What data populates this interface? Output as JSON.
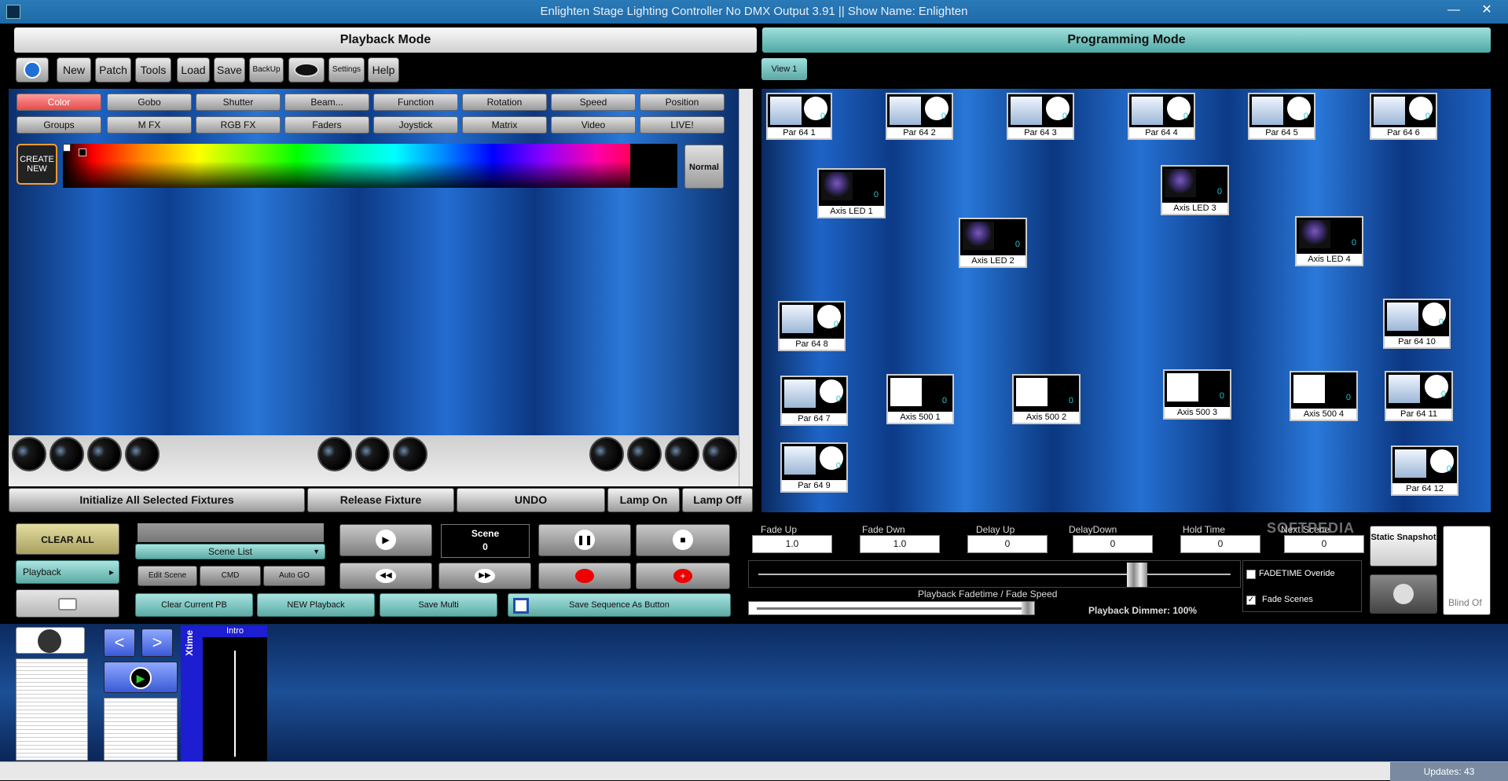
{
  "window": {
    "title": "Enlighten Stage Lighting Controller No DMX Output 3.91 || Show Name: Enlighten",
    "minimize": "—",
    "close": "✕"
  },
  "headers": {
    "playback": "Playback Mode",
    "programming": "Programming Mode"
  },
  "toolbar": {
    "items": [
      "New",
      "Patch",
      "Tools",
      "Load",
      "Save",
      "BackUp",
      "",
      "Settings",
      "Help"
    ]
  },
  "view": {
    "label": "View 1"
  },
  "tabs": {
    "row1": [
      "Color",
      "Gobo",
      "Shutter",
      "Beam...",
      "Function",
      "Rotation",
      "Speed",
      "Position"
    ],
    "row2": [
      "Groups",
      "M FX",
      "RGB FX",
      "Faders",
      "Joystick",
      "Matrix",
      "Video",
      "LIVE!"
    ],
    "active": "Color"
  },
  "color_panel": {
    "create_new": "CREATE NEW",
    "normal": "Normal"
  },
  "left_actions": [
    "Initialize All Selected Fixtures",
    "Release Fixture",
    "UNDO",
    "Lamp On",
    "Lamp Off"
  ],
  "fixtures": [
    {
      "name": "Par 64 1",
      "kind": "par",
      "value": "0"
    },
    {
      "name": "Par 64 2",
      "kind": "par",
      "value": "0"
    },
    {
      "name": "Par 64 3",
      "kind": "par",
      "value": "0"
    },
    {
      "name": "Par 64 4",
      "kind": "par",
      "value": "0"
    },
    {
      "name": "Par 64 5",
      "kind": "par",
      "value": "0"
    },
    {
      "name": "Par 64 6",
      "kind": "par",
      "value": "0"
    },
    {
      "name": "Axis LED 1",
      "kind": "led",
      "value": "0"
    },
    {
      "name": "Axis LED 3",
      "kind": "led",
      "value": "0"
    },
    {
      "name": "Axis LED 2",
      "kind": "led",
      "value": "0"
    },
    {
      "name": "Axis LED 4",
      "kind": "led",
      "value": "0"
    },
    {
      "name": "Par 64 8",
      "kind": "par",
      "value": "0"
    },
    {
      "name": "Par 64 10",
      "kind": "par",
      "value": "0"
    },
    {
      "name": "Par 64 7",
      "kind": "par",
      "value": "0"
    },
    {
      "name": "Axis 500 1",
      "kind": "mh",
      "value": "0"
    },
    {
      "name": "Axis 500 2",
      "kind": "mh",
      "value": "0"
    },
    {
      "name": "Axis 500 3",
      "kind": "mh",
      "value": "0"
    },
    {
      "name": "Axis 500 4",
      "kind": "mh",
      "value": "0"
    },
    {
      "name": "Par 64 11",
      "kind": "par",
      "value": "0"
    },
    {
      "name": "Par 64 9",
      "kind": "par",
      "value": "0"
    },
    {
      "name": "Par 64 12",
      "kind": "par",
      "value": "0"
    }
  ],
  "playback": {
    "clear_all": "CLEAR ALL",
    "mode": "Playback",
    "scene_list": "Scene List",
    "edit_scene": "Edit Scene",
    "cmd": "CMD",
    "auto_go": "Auto GO",
    "clear_current": "Clear Current PB",
    "new_playback": "NEW Playback",
    "save_multi": "Save Multi",
    "save_sequence": "Save Sequence As Button",
    "scene_label": "Scene",
    "scene_value": "0"
  },
  "params": [
    {
      "label": "Fade Up",
      "value": "1.0"
    },
    {
      "label": "Fade Dwn",
      "value": "1.0"
    },
    {
      "label": "Delay Up",
      "value": "0"
    },
    {
      "label": "DelayDown",
      "value": "0"
    },
    {
      "label": "Hold Time",
      "value": "0"
    },
    {
      "label": "Next Scene",
      "value": "0"
    }
  ],
  "fade": {
    "title": "Playback Fadetime / Fade Speed",
    "dimmer": "Playback Dimmer: 100%",
    "fadetime_override": "FADETIME Overide",
    "fade_scenes": "Fade Scenes",
    "fadetime_override_checked": false,
    "fade_scenes_checked": true
  },
  "snapshot": {
    "static": "Static Snapshot",
    "blind": "Blind Of"
  },
  "sequencer": {
    "xtime": "Xtime",
    "intro": "Intro"
  },
  "status": {
    "updates": "Updates: 43"
  },
  "watermark": "SOFTPEDIA"
}
